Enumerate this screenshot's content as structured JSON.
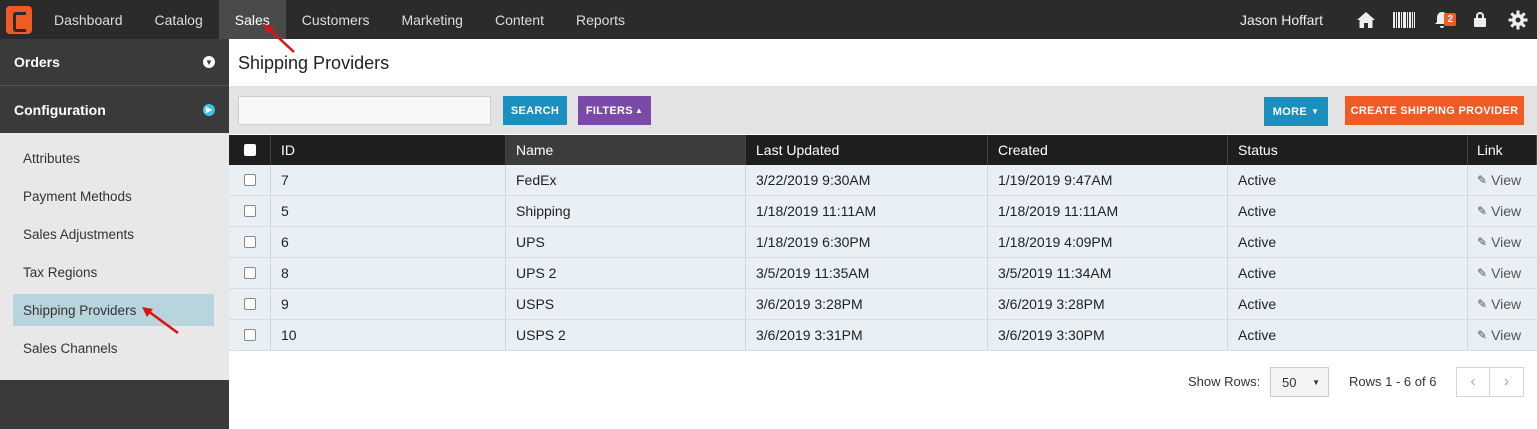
{
  "nav": {
    "items": [
      "Dashboard",
      "Catalog",
      "Sales",
      "Customers",
      "Marketing",
      "Content",
      "Reports"
    ],
    "user": "Jason Hoffart",
    "notifications_count": "2",
    "icons": [
      "home-icon",
      "barcode-icon",
      "bell-icon",
      "lock-icon",
      "gear-icon"
    ]
  },
  "sidebar": {
    "sections": [
      {
        "label": "Orders",
        "icon": "chevron-down-icon"
      },
      {
        "label": "Configuration",
        "icon": "chevron-right-icon"
      }
    ],
    "items": [
      "Attributes",
      "Payment Methods",
      "Sales Adjustments",
      "Tax Regions",
      "Shipping Providers",
      "Sales Channels"
    ]
  },
  "main": {
    "title": "Shipping Providers",
    "search": {
      "value": "",
      "placeholder": ""
    },
    "buttons": {
      "search": "SEARCH",
      "filters": "FILTERS",
      "more": "MORE",
      "create": "CREATE SHIPPING PROVIDER"
    }
  },
  "table": {
    "columns": [
      "ID",
      "Name",
      "Last Updated",
      "Created",
      "Status",
      "Link"
    ],
    "rows": [
      {
        "id": "7",
        "name": "FedEx",
        "updated": "3/22/2019 9:30AM",
        "created": "1/19/2019 9:47AM",
        "status": "Active",
        "link": "View"
      },
      {
        "id": "5",
        "name": "Shipping",
        "updated": "1/18/2019 11:11AM",
        "created": "1/18/2019 11:11AM",
        "status": "Active",
        "link": "View"
      },
      {
        "id": "6",
        "name": "UPS",
        "updated": "1/18/2019 6:30PM",
        "created": "1/18/2019 4:09PM",
        "status": "Active",
        "link": "View"
      },
      {
        "id": "8",
        "name": "UPS 2",
        "updated": "3/5/2019 11:35AM",
        "created": "3/5/2019 11:34AM",
        "status": "Active",
        "link": "View"
      },
      {
        "id": "9",
        "name": "USPS",
        "updated": "3/6/2019 3:28PM",
        "created": "3/6/2019 3:28PM",
        "status": "Active",
        "link": "View"
      },
      {
        "id": "10",
        "name": "USPS 2",
        "updated": "3/6/2019 3:31PM",
        "created": "3/6/2019 3:30PM",
        "status": "Active",
        "link": "View"
      }
    ]
  },
  "footer": {
    "show_rows_label": "Show Rows:",
    "rows_per_page": "50",
    "range": "Rows 1 - 6 of 6"
  },
  "colors": {
    "brand": "#f05a24",
    "primary": "#1b8fc0",
    "filters": "#7a4aa8",
    "nav_bg": "#2b2b2b",
    "annotation": "#e01010"
  }
}
